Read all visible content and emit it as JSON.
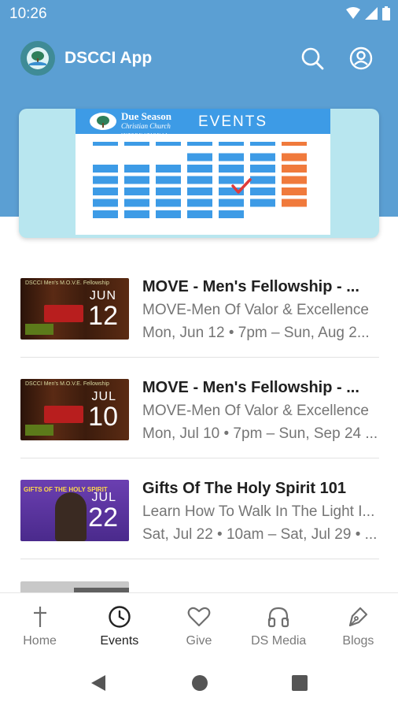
{
  "status_bar": {
    "time": "10:26"
  },
  "app_bar": {
    "title": "DSCCI App"
  },
  "banner": {
    "brand_line1": "Due Season",
    "brand_line2": "Christian Church",
    "brand_line3": "INTERNATIONAL",
    "heading": "EVENTS"
  },
  "events": [
    {
      "title": "MOVE - Men's Fellowship - ...",
      "subtitle": "MOVE-Men Of Valor & Excellence",
      "date": "Mon, Jun 12 • 7pm – Sun, Aug 2...",
      "thumb_month": "JUN",
      "thumb_day": "12"
    },
    {
      "title": "MOVE - Men's Fellowship - ...",
      "subtitle": "MOVE-Men Of Valor & Excellence",
      "date": "Mon, Jul 10 • 7pm – Sun, Sep 24 ...",
      "thumb_month": "JUL",
      "thumb_day": "10"
    },
    {
      "title": "Gifts Of The Holy Spirit 101",
      "subtitle": "Learn How To Walk In The Light I...",
      "date": "Sat, Jul 22 • 10am – Sat, Jul 29 • ...",
      "thumb_month": "JUL",
      "thumb_day": "22"
    }
  ],
  "bottom_nav": [
    {
      "label": "Home",
      "icon": "cross-icon"
    },
    {
      "label": "Events",
      "icon": "clock-icon",
      "active": true
    },
    {
      "label": "Give",
      "icon": "heart-icon"
    },
    {
      "label": "DS Media",
      "icon": "headphones-icon"
    },
    {
      "label": "Blogs",
      "icon": "pen-icon"
    }
  ],
  "colors": {
    "header_blue": "#5b9fd3",
    "banner_bg": "#b8e6ef",
    "calendar_blue": "#3d9be6",
    "calendar_orange": "#f07a3c",
    "check_red": "#e03a3a"
  }
}
